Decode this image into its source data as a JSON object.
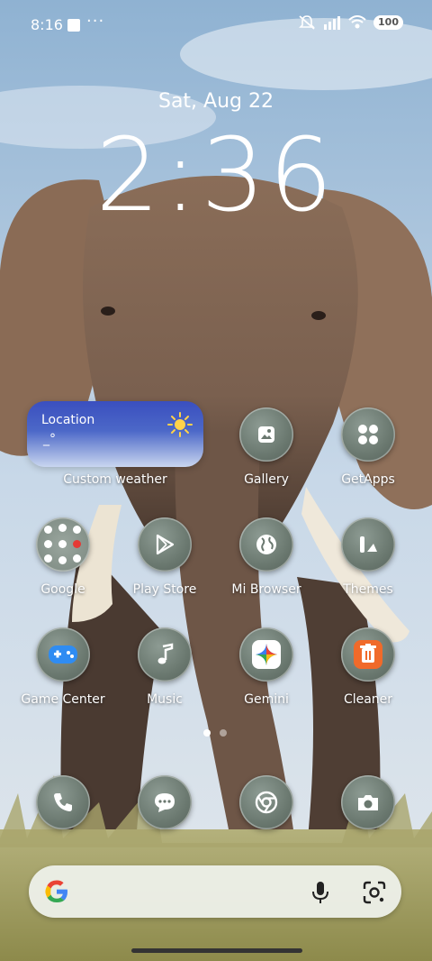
{
  "status_bar": {
    "time": "8:16",
    "overflow": "···",
    "battery": "100"
  },
  "lock_info": {
    "date": "Sat, Aug 22",
    "clock": "2:36"
  },
  "weather_widget": {
    "location": "Location",
    "temperature": "_°",
    "label": "Custom weather"
  },
  "apps": {
    "gallery": "Gallery",
    "getapps": "GetApps",
    "google": "Google",
    "play_store": "Play Store",
    "mi_browser": "Mi Browser",
    "themes": "Themes",
    "game_center": "Game Center",
    "music": "Music",
    "gemini": "Gemini",
    "cleaner": "Cleaner"
  },
  "pages": {
    "count": 2,
    "current": 1
  },
  "colors": {
    "accent_cleaner": "#f06a2a",
    "gemini_blue": "#3b7cf1",
    "search_bg": "#eef2ec"
  }
}
